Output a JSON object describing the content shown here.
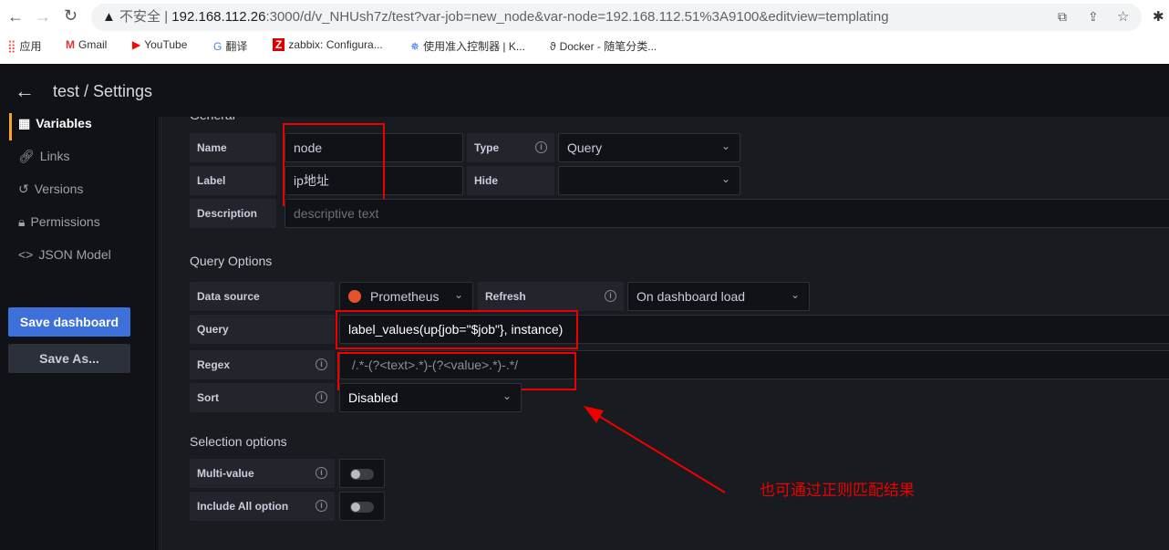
{
  "browser": {
    "insecure": "不安全",
    "url_host": "192.168.112.26",
    "url_rest": ":3000/d/v_NHUsh7z/test?var-job=new_node&var-node=192.168.112.51%3A9100&editview=templating",
    "bookmarks": [
      "应用",
      "Gmail",
      "YouTube",
      "翻译",
      "zabbix: Configura...",
      "使用准入控制器 | K...",
      "Docker - 随笔分类..."
    ]
  },
  "header": {
    "title": "test / Settings"
  },
  "sidebar": {
    "items": [
      {
        "label": "Variables",
        "icon": "grid-icon"
      },
      {
        "label": "Links",
        "icon": "link-icon"
      },
      {
        "label": "Versions",
        "icon": "history-icon"
      },
      {
        "label": "Permissions",
        "icon": "lock-icon"
      },
      {
        "label": "JSON Model",
        "icon": "code-icon"
      }
    ],
    "save": "Save dashboard",
    "save_as": "Save As..."
  },
  "general": {
    "heading": "General",
    "name_label": "Name",
    "name_value": "node",
    "type_label": "Type",
    "type_value": "Query",
    "label_label": "Label",
    "label_value": "ip地址",
    "hide_label": "Hide",
    "hide_value": "",
    "desc_label": "Description",
    "desc_placeholder": "descriptive text"
  },
  "query": {
    "heading": "Query Options",
    "ds_label": "Data source",
    "ds_value": "Prometheus",
    "refresh_label": "Refresh",
    "refresh_value": "On dashboard load",
    "query_label": "Query",
    "query_value": "label_values(up{job=\"$job\"}, instance)",
    "regex_label": "Regex",
    "regex_value": "/.*-(?<text>.*)-(?<value>.*)-.*/",
    "sort_label": "Sort",
    "sort_value": "Disabled"
  },
  "selection": {
    "heading": "Selection options",
    "multi_label": "Multi-value",
    "multi_on": false,
    "all_label": "Include All option",
    "all_on": false
  },
  "annotation": {
    "text": "也可通过正则匹配结果",
    "color": "#e00000"
  },
  "colors": {
    "primary": "#3d71d9",
    "accent": "#f5a623"
  }
}
